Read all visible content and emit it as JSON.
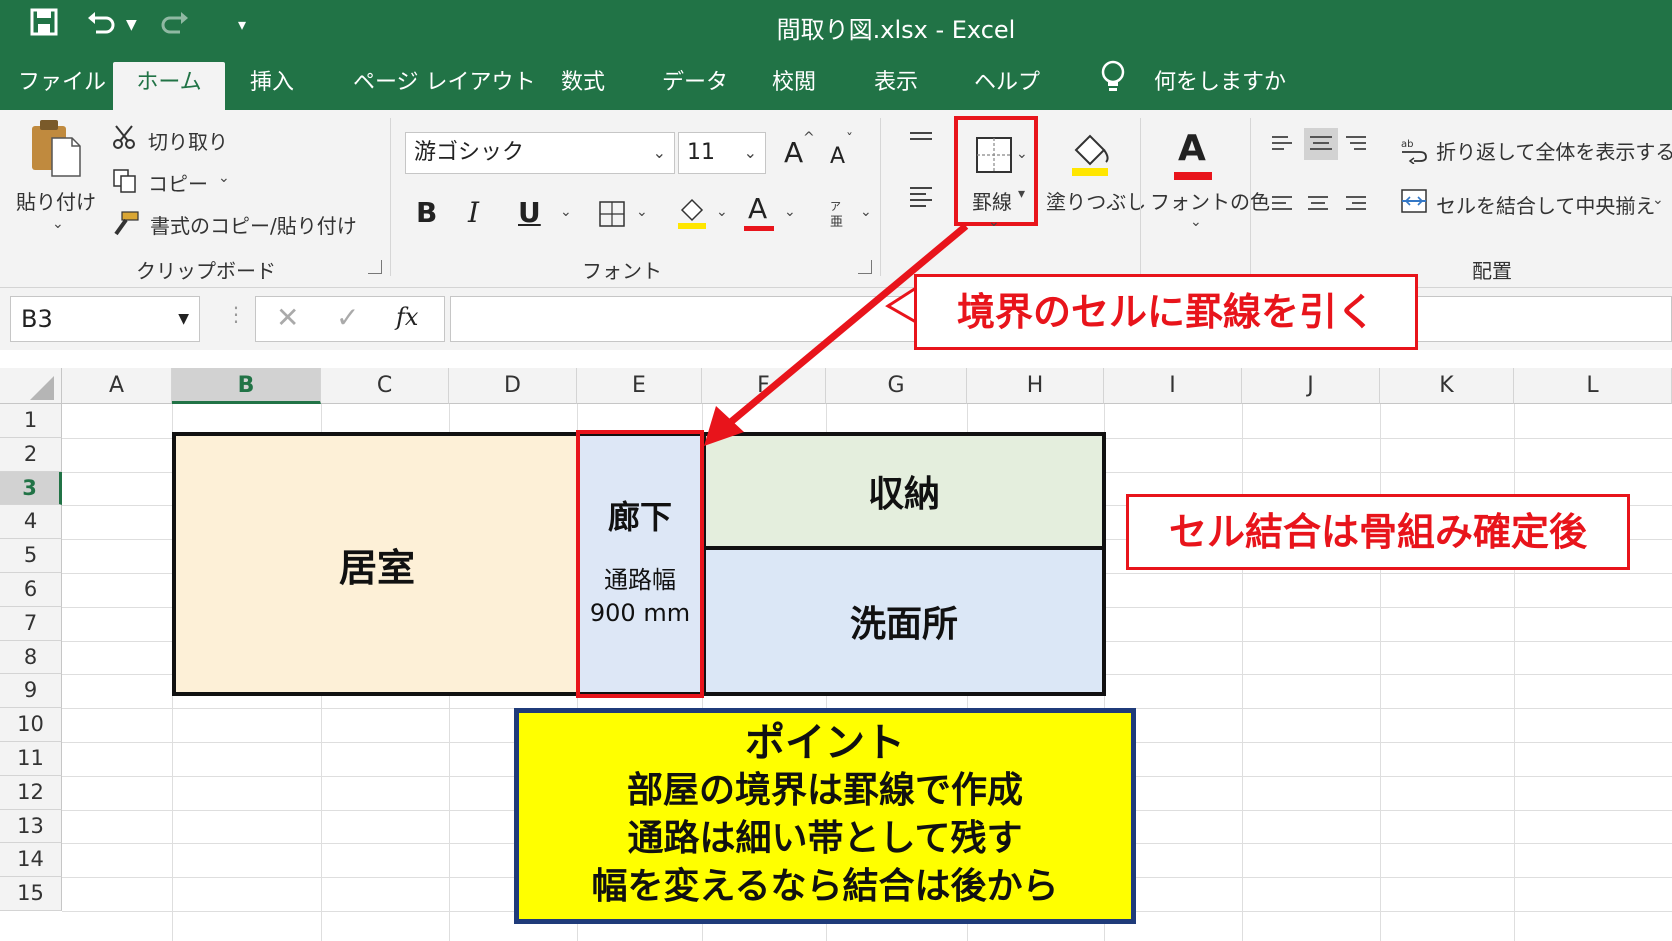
{
  "window": {
    "title": "間取り図.xlsx  -  Excel"
  },
  "menu": {
    "tabs": [
      "ファイル",
      "ホーム",
      "挿入",
      "ページ レイアウト",
      "数式",
      "データ",
      "校閲",
      "表示",
      "ヘルプ"
    ],
    "active_tab": "ホーム",
    "tell_me": "何をしますか"
  },
  "ribbon": {
    "clipboard": {
      "paste": "貼り付け",
      "cut": "切り取り",
      "copy": "コピー",
      "format_painter": "書式のコピー/貼り付け",
      "group_label": "クリップボード"
    },
    "font": {
      "font_name": "游ゴシック",
      "font_size": "11",
      "bold": "B",
      "italic": "I",
      "underline": "U",
      "font_color_glyph": "A",
      "grow_glyph": "A",
      "group_label": "フォント"
    },
    "borders_label": "罫線",
    "fill_label": "塗りつぶし",
    "font_color_label": "フォントの色",
    "alignment": {
      "wrap_text": "折り返して全体を表示する",
      "merge_center": "セルを結合して中央揃え",
      "group_label": "配置"
    }
  },
  "formula_bar": {
    "name_box": "B3",
    "fx": "fx",
    "value": ""
  },
  "grid": {
    "columns": [
      "A",
      "B",
      "C",
      "D",
      "E",
      "F",
      "G",
      "H",
      "I",
      "J",
      "K",
      "L"
    ],
    "rows": [
      "1",
      "2",
      "3",
      "4",
      "5",
      "6",
      "7",
      "8",
      "9",
      "10",
      "11",
      "12",
      "13",
      "14",
      "15"
    ],
    "selected_column": "B",
    "selected_row": "3"
  },
  "floor_plan": {
    "living_room": "居室",
    "corridor": "廊下",
    "corridor_width_label": "通路幅",
    "corridor_width_value": "900 mm",
    "storage": "収納",
    "washroom": "洗面所",
    "colors": {
      "living_room": "#fdf0d7",
      "corridor": "#dde7f6",
      "storage": "#e4eedd",
      "washroom": "#dbe7f6"
    }
  },
  "annotations": {
    "border_callout": "境界のセルに罫線を引く",
    "merge_callout": "セル結合は骨組み確定後",
    "point_title": "ポイント",
    "point_lines": [
      "部屋の境界は罫線で作成",
      "通路は細い帯として残す",
      "幅を変えるなら結合は後から"
    ]
  },
  "theme": {
    "excel_green": "#217346",
    "highlight_red": "#e8141b",
    "point_yellow": "#ffff00",
    "point_border": "#1f3b7a"
  }
}
